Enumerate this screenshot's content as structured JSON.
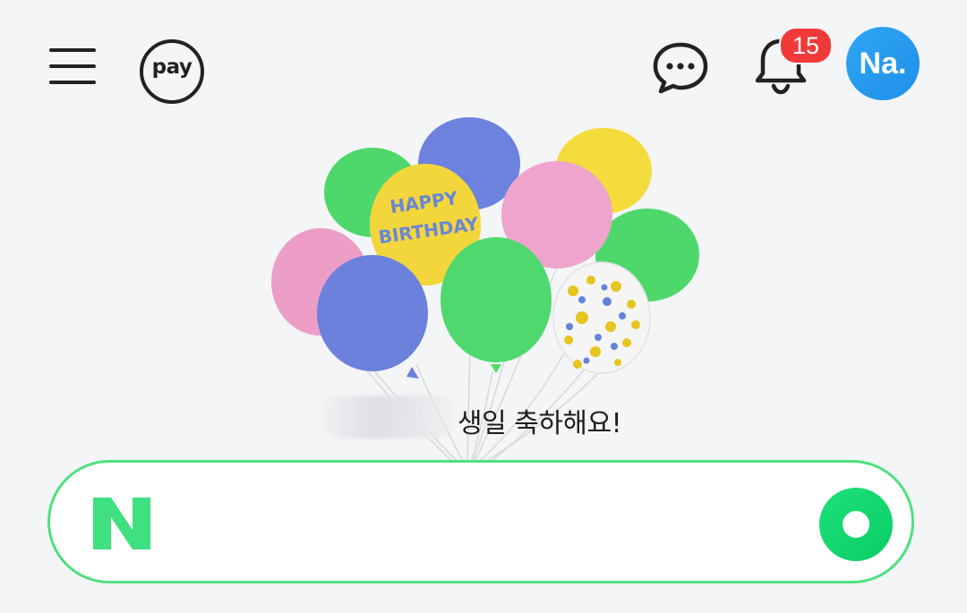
{
  "header": {
    "menu_icon": "hamburger-menu-icon",
    "pay_label": "pay",
    "chat_icon": "chat-bubble-icon",
    "bell_icon": "bell-icon",
    "notification_count": "15",
    "avatar_label": "Na."
  },
  "birthday": {
    "balloon_text_line1": "HAPPY",
    "balloon_text_line2": "BIRTHDAY",
    "greeting": "생일 축하해요!"
  },
  "search": {
    "logo_letter": "N",
    "placeholder": "",
    "value": ""
  },
  "colors": {
    "accent_green": "#03C75A",
    "badge_red": "#F03A3A",
    "avatar_blue": "#2FA6F5"
  }
}
